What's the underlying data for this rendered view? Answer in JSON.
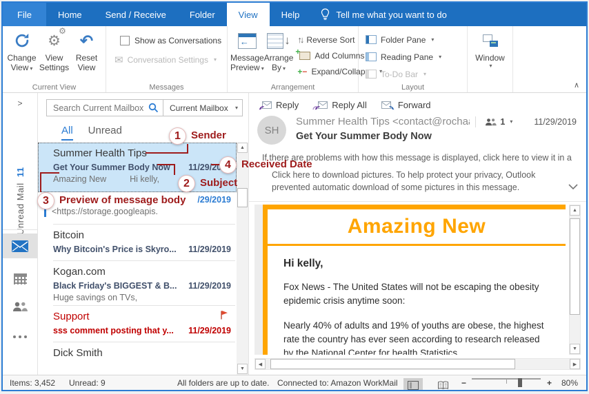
{
  "titlebar": {
    "tabs": [
      {
        "label": "File"
      },
      {
        "label": "Home"
      },
      {
        "label": "Send / Receive"
      },
      {
        "label": "Folder"
      },
      {
        "label": "View"
      },
      {
        "label": "Help"
      }
    ],
    "tell_me": "Tell me what you want to do"
  },
  "ribbon": {
    "change_view": "Change View",
    "view_settings": "View Settings",
    "reset_view": "Reset View",
    "show_as_conversations": "Show as Conversations",
    "conversation_settings": "Conversation Settings",
    "message_preview": "Message Preview",
    "arrange_by": "Arrange By",
    "reverse_sort": "Reverse Sort",
    "add_columns": "Add Columns",
    "expand_collapse": "Expand/Collapse",
    "folder_pane": "Folder Pane",
    "reading_pane": "Reading Pane",
    "todo_bar": "To-Do Bar",
    "window": "Window",
    "groups": {
      "current_view": "Current View",
      "messages": "Messages",
      "arrangement": "Arrangement",
      "layout": "Layout"
    }
  },
  "nav_rail": {
    "unread_label": "Unread Mail",
    "unread_count": "11"
  },
  "search": {
    "placeholder": "Search Current Mailbox",
    "scope": "Current Mailbox"
  },
  "list_tabs": {
    "all": "All",
    "unread": "Unread"
  },
  "messages": [
    {
      "sender": "Summer Health Tips",
      "subject": "Get Your Summer Body Now",
      "date": "11/29/2019",
      "preview_a": "Amazing New",
      "preview_b": "Hi kelly,"
    },
    {
      "date": "/29/2019",
      "preview": "<https://storage.googleapis."
    },
    {
      "sender": "Bitcoin",
      "subject": "Why Bitcoin's Price is Skyro...",
      "date": "11/29/2019"
    },
    {
      "sender": "Kogan.com",
      "subject": "Black Friday's BIGGEST & B...",
      "date": "11/29/2019",
      "preview": "Huge savings on TVs,"
    },
    {
      "sender": "Support",
      "subject": "sss comment posting that y...",
      "date": "11/29/2019"
    },
    {
      "sender": "Dick Smith"
    }
  ],
  "annotations": [
    {
      "num": "1",
      "label": "Sender"
    },
    {
      "num": "2",
      "label": "Subject"
    },
    {
      "num": "3",
      "label": "Preview of message body"
    },
    {
      "num": "4",
      "label": "Received Date"
    }
  ],
  "reading": {
    "reply": "Reply",
    "reply_all": "Reply All",
    "forward": "Forward",
    "avatar_initials": "SH",
    "from": "Summer Health Tips <contact@rochaa",
    "recipient_count": "1",
    "date": "11/29/2019",
    "subject": "Get Your Summer Body Now",
    "info_browser": "If there are problems with how this message is displayed, click here to view it in a",
    "info_pictures": "Click here to download pictures. To help protect your privacy, Outlook prevented automatic download of some pictures in this message.",
    "body": {
      "heading": "Amazing New",
      "greeting": "Hi kelly,",
      "para1": "Fox News - The United States will not be escaping the obesity epidemic crisis anytime soon:",
      "para2": "Nearly 40% of adults and 19% of youths are obese, the highest rate the country has ever seen according to research released by the National Center for health Statistics."
    }
  },
  "statusbar": {
    "items": "Items: 3,452",
    "unread": "Unread: 9",
    "folders": "All folders are up to date.",
    "connected": "Connected to: Amazon WorkMail",
    "zoom": "80%"
  },
  "colors": {
    "ribbon_blue": "#1d6fc0",
    "accent_blue": "#2b7cd3",
    "selection_blue": "#cbe5f8",
    "annotation_red": "#9e1b1b",
    "alert_red": "#c00000",
    "body_orange": "#ffa500"
  }
}
